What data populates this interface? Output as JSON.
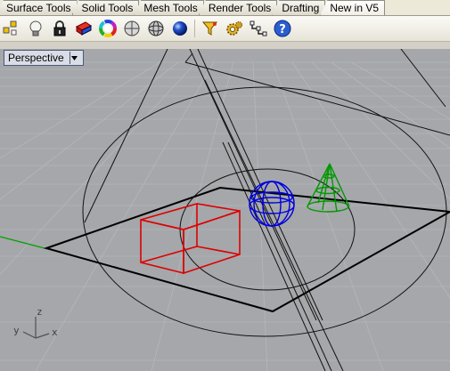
{
  "tabs": [
    "Surface Tools",
    "Solid Tools",
    "Mesh Tools",
    "Render Tools",
    "Drafting",
    "New in V5"
  ],
  "toolbar": {
    "buttons": [
      "points-icon",
      "lightbulb-icon",
      "lock-icon",
      "layer-color-icon",
      "color-wheel-icon",
      "shaded-sphere-icon",
      "render-sphere-icon",
      "blue-sphere-icon",
      "filter-icon",
      "gear-icon",
      "network-icon",
      "help-icon"
    ]
  },
  "viewport": {
    "title": "Perspective",
    "background_color": "#a5a7aa",
    "axes": {
      "z": "z",
      "y": "y",
      "x": "x"
    },
    "objects": [
      {
        "name": "box",
        "color": "#dd0000"
      },
      {
        "name": "sphere",
        "color": "#0000dd"
      },
      {
        "name": "cone",
        "color": "#009900"
      }
    ]
  }
}
